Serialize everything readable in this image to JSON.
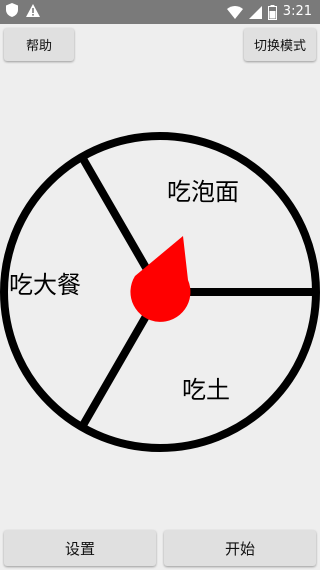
{
  "status_bar": {
    "time": "3:21"
  },
  "toolbar": {
    "help_label": "帮助",
    "mode_label": "切换模式"
  },
  "wheel": {
    "options": [
      {
        "label": "吃泡面"
      },
      {
        "label": "吃大餐"
      },
      {
        "label": "吃土"
      }
    ],
    "pointer_color": "#ff0000"
  },
  "footer": {
    "settings_label": "设置",
    "start_label": "开始"
  },
  "colors": {
    "background": "#eeeeee",
    "button": "#e0e0e0",
    "status_bar": "#7a7a7a"
  }
}
